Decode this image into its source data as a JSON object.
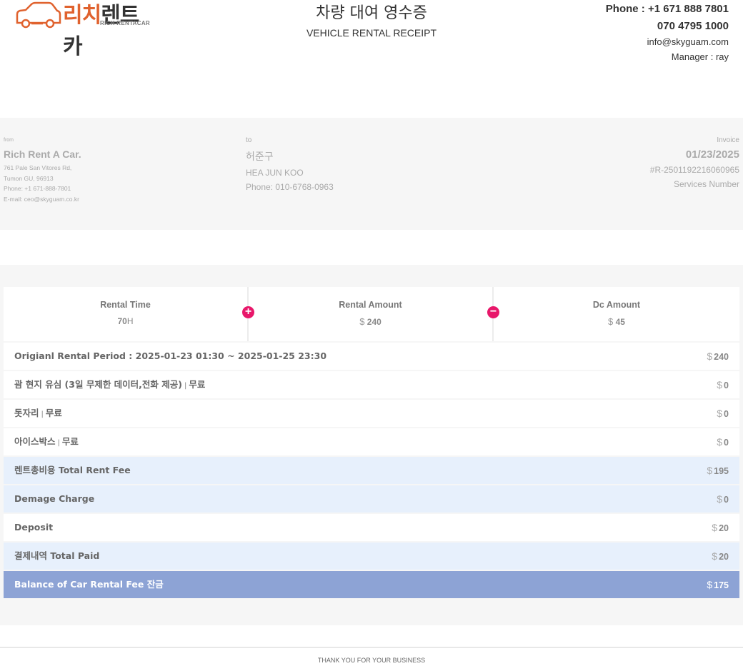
{
  "logo": {
    "ko_red": "리치",
    "ko_dark": "렌트카",
    "en": "RICH RENTACAR"
  },
  "title": {
    "ko": "차량 대여 영수증",
    "en": "VEHICLE RENTAL RECEIPT"
  },
  "contact": {
    "phone1": "Phone : +1 671 888 7801",
    "phone2": "070 4795 1000",
    "email": "info@skyguam.com",
    "manager": "Manager : ray"
  },
  "from": {
    "label": "from",
    "name": "Rich Rent A Car.",
    "address1": "761 Pale San Vitores Rd,",
    "address2": "Tumon GU, 96913",
    "phone": "Phone: +1 671-888-7801",
    "email": "E-mail: ceo@skyguam.co.kr"
  },
  "to": {
    "label": "to",
    "name_ko": "허준구",
    "name_en": "HEA JUN KOO",
    "phone": "Phone: 010-6768-0963"
  },
  "invoice": {
    "label": "Invoice",
    "date": "01/23/2025",
    "number": "#R-2501192216060965",
    "services": "Services Number"
  },
  "stats": {
    "rental_time": {
      "label": "Rental Time",
      "value": "70",
      "unit": "H"
    },
    "rental_amount": {
      "label": "Rental Amount",
      "currency": "$",
      "value": "240"
    },
    "dc_amount": {
      "label": "Dc Amount",
      "currency": "$",
      "value": "45"
    },
    "plus_icon": "+",
    "minus_icon": "−"
  },
  "rows": [
    {
      "label": "Origianl Rental Period : 2025-01-23 01:30 ~ 2025-01-25 23:30",
      "sub": "",
      "currency": "$",
      "amount": "240",
      "style": "white"
    },
    {
      "label": "괌 현지 유심 (3일 무제한 데이터,전화 제공)",
      "sub": "무료",
      "currency": "$",
      "amount": "0",
      "style": "white"
    },
    {
      "label": "돗자리",
      "sub": "무료",
      "currency": "$",
      "amount": "0",
      "style": "white"
    },
    {
      "label": "아이스박스",
      "sub": "무료",
      "currency": "$",
      "amount": "0",
      "style": "white"
    },
    {
      "label": "렌트총비용 Total Rent Fee",
      "sub": "",
      "currency": "$",
      "amount": "195",
      "style": "blue"
    },
    {
      "label": "Demage Charge",
      "sub": "",
      "currency": "$",
      "amount": "0",
      "style": "blue"
    },
    {
      "label": "Deposit",
      "sub": "",
      "currency": "$",
      "amount": "20",
      "style": "white"
    },
    {
      "label": "결제내역 Total Paid",
      "sub": "",
      "currency": "$",
      "amount": "20",
      "style": "blue"
    },
    {
      "label": "Balance of Car Rental Fee 잔금",
      "sub": "",
      "currency": "$",
      "amount": "175",
      "style": "dark"
    }
  ],
  "separator": "|",
  "footer": "THANK YOU FOR YOUR BUSINESS",
  "colors": {
    "accent_pink": "#e8176a",
    "logo_orange": "#e0622e",
    "balance_row": "#8da3d5",
    "highlight_row": "#e7f0fc"
  }
}
